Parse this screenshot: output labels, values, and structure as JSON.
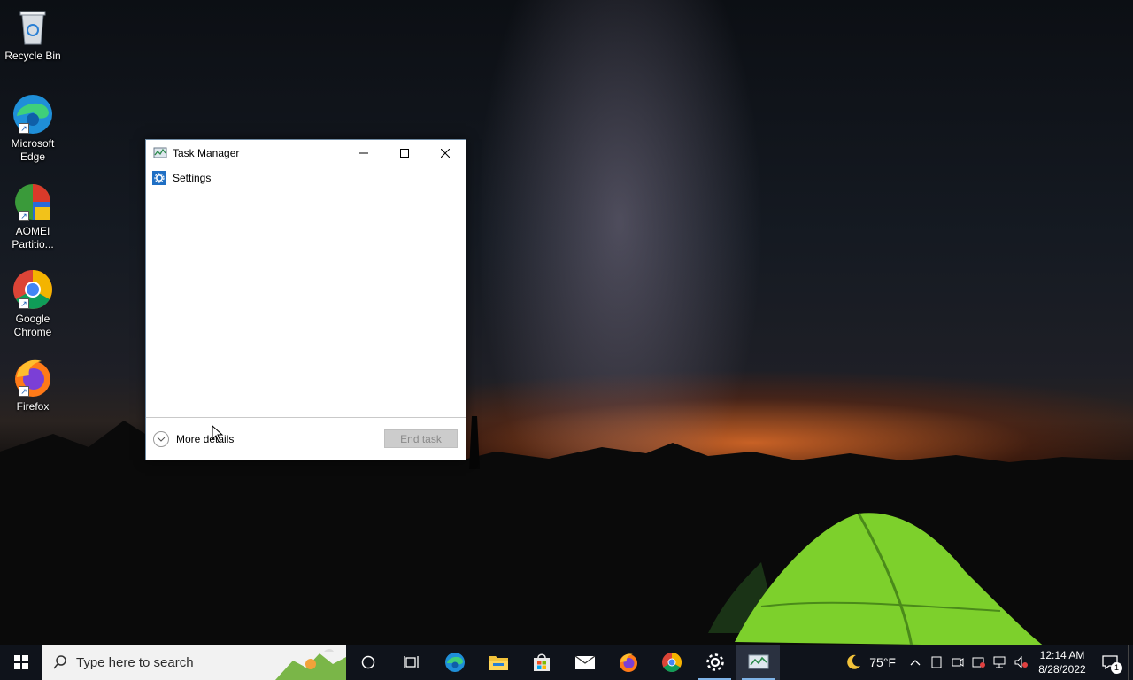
{
  "desktop": {
    "icons": [
      {
        "label": "Recycle Bin",
        "icon": "recycle-bin-icon"
      },
      {
        "label": "Microsoft Edge",
        "icon": "edge-icon"
      },
      {
        "label": "AOMEI Partitio...",
        "icon": "aomei-icon"
      },
      {
        "label": "Google Chrome",
        "icon": "chrome-icon"
      },
      {
        "label": "Firefox",
        "icon": "firefox-icon"
      }
    ]
  },
  "task_manager": {
    "title": "Task Manager",
    "apps": [
      {
        "label": "Settings",
        "icon": "settings-gear-icon"
      }
    ],
    "more_details_label": "More details",
    "end_task_label": "End task"
  },
  "taskbar": {
    "search_placeholder": "Type here to search",
    "weather": "75°F",
    "time": "12:14 AM",
    "date": "8/28/2022",
    "notification_count": "1",
    "pinned": [
      "cortana-icon",
      "task-view-icon",
      "edge-icon",
      "file-explorer-icon",
      "microsoft-store-icon",
      "mail-icon",
      "firefox-icon",
      "chrome-icon",
      "settings-icon",
      "task-manager-icon"
    ]
  }
}
